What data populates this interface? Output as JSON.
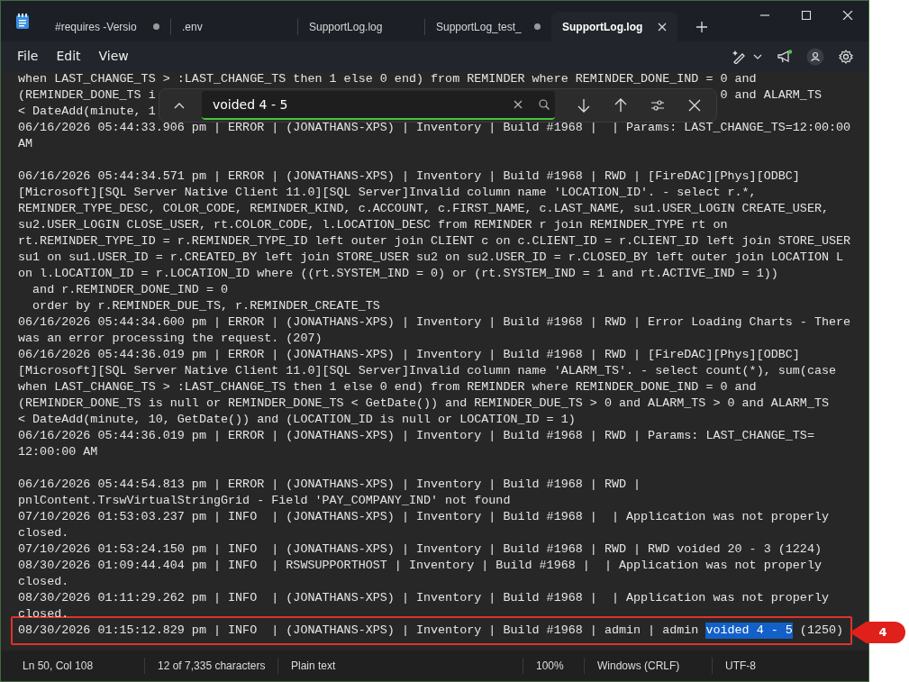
{
  "tabs": [
    {
      "label": "#requires -Versio",
      "modified": true,
      "selected": false
    },
    {
      "label": ".env",
      "modified": false,
      "selected": false
    },
    {
      "label": "SupportLog.log",
      "modified": false,
      "selected": false
    },
    {
      "label": "SupportLog_test_",
      "modified": true,
      "selected": false
    },
    {
      "label": "SupportLog.log",
      "modified": false,
      "selected": true
    }
  ],
  "menu": [
    "File",
    "Edit",
    "View"
  ],
  "find": {
    "value": "voided 4 - 5"
  },
  "lines": [
    {
      "kind": "text",
      "text": "when LAST_CHANGE_TS > :LAST_CHANGE_TS then 1 else 0 end) from REMINDER where REMINDER_DONE_IND = 0 and"
    },
    {
      "kind": "covered",
      "before": "(REMINDER_DONE_TS i",
      "after": "0 and ALARM_TS"
    },
    {
      "kind": "covered",
      "before": "< DateAdd(minute, 1"
    },
    {
      "kind": "text",
      "text": "06/16/2026 05:44:33.906 pm | ERROR | (JONATHANS-XPS) | Inventory | Build #1968 |  | Params: LAST_CHANGE_TS=12:00:00"
    },
    {
      "kind": "text",
      "text": "AM"
    },
    {
      "kind": "blank"
    },
    {
      "kind": "text",
      "text": "06/16/2026 05:44:34.571 pm | ERROR | (JONATHANS-XPS) | Inventory | Build #1968 | RWD | [FireDAC][Phys][ODBC]"
    },
    {
      "kind": "text",
      "text": "[Microsoft][SQL Server Native Client 11.0][SQL Server]Invalid column name 'LOCATION_ID'. - select r.*,"
    },
    {
      "kind": "text",
      "text": "REMINDER_TYPE_DESC, COLOR_CODE, REMINDER_KIND, c.ACCOUNT, c.FIRST_NAME, c.LAST_NAME, su1.USER_LOGIN CREATE_USER,"
    },
    {
      "kind": "text",
      "text": "su2.USER_LOGIN CLOSE_USER, rt.COLOR_CODE, l.LOCATION_DESC from REMINDER r join REMINDER_TYPE rt on"
    },
    {
      "kind": "text",
      "text": "rt.REMINDER_TYPE_ID = r.REMINDER_TYPE_ID left outer join CLIENT c on c.CLIENT_ID = r.CLIENT_ID left join STORE_USER"
    },
    {
      "kind": "text",
      "text": "su1 on su1.USER_ID = r.CREATED_BY left join STORE_USER su2 on su2.USER_ID = r.CLOSED_BY left outer join LOCATION L"
    },
    {
      "kind": "text",
      "text": "on l.LOCATION_ID = r.LOCATION_ID where ((rt.SYSTEM_IND = 0) or (rt.SYSTEM_IND = 1 and rt.ACTIVE_IND = 1))"
    },
    {
      "kind": "text",
      "text": "  and r.REMINDER_DONE_IND = 0"
    },
    {
      "kind": "text",
      "text": "  order by r.REMINDER_DUE_TS, r.REMINDER_CREATE_TS"
    },
    {
      "kind": "text",
      "text": "06/16/2026 05:44:34.600 pm | ERROR | (JONATHANS-XPS) | Inventory | Build #1968 | RWD | Error Loading Charts - There"
    },
    {
      "kind": "text",
      "text": "was an error processing the request. (207)"
    },
    {
      "kind": "text",
      "text": "06/16/2026 05:44:36.019 pm | ERROR | (JONATHANS-XPS) | Inventory | Build #1968 | RWD | [FireDAC][Phys][ODBC]"
    },
    {
      "kind": "text",
      "text": "[Microsoft][SQL Server Native Client 11.0][SQL Server]Invalid column name 'ALARM_TS'. - select count(*), sum(case"
    },
    {
      "kind": "text",
      "text": "when LAST_CHANGE_TS > :LAST_CHANGE_TS then 1 else 0 end) from REMINDER where REMINDER_DONE_IND = 0 and"
    },
    {
      "kind": "text",
      "text": "(REMINDER_DONE_TS is null or REMINDER_DONE_TS < GetDate()) and REMINDER_DUE_TS > 0 and ALARM_TS > 0 and ALARM_TS"
    },
    {
      "kind": "text",
      "text": "< DateAdd(minute, 10, GetDate()) and (LOCATION_ID is null or LOCATION_ID = 1)"
    },
    {
      "kind": "text",
      "text": "06/16/2026 05:44:36.019 pm | ERROR | (JONATHANS-XPS) | Inventory | Build #1968 | RWD | Params: LAST_CHANGE_TS="
    },
    {
      "kind": "text",
      "text": "12:00:00 AM"
    },
    {
      "kind": "blank"
    },
    {
      "kind": "text",
      "text": "06/16/2026 05:44:54.813 pm | ERROR | (JONATHANS-XPS) | Inventory | Build #1968 | RWD |"
    },
    {
      "kind": "text",
      "text": "pnlContent.TrswVirtualStringGrid - Field 'PAY_COMPANY_IND' not found"
    },
    {
      "kind": "text",
      "text": "07/10/2026 01:53:03.237 pm | INFO  | (JONATHANS-XPS) | Inventory | Build #1968 |  | Application was not properly"
    },
    {
      "kind": "text",
      "text": "closed."
    },
    {
      "kind": "text",
      "text": "07/10/2026 01:53:24.150 pm | INFO  | (JONATHANS-XPS) | Inventory | Build #1968 | RWD | RWD voided 20 - 3 (1224)"
    },
    {
      "kind": "text",
      "text": "08/30/2026 01:09:44.404 pm | INFO  | RSWSUPPORTHOST | Inventory | Build #1968 |  | Application was not properly"
    },
    {
      "kind": "text",
      "text": "closed."
    },
    {
      "kind": "text",
      "text": "08/30/2026 01:11:29.262 pm | INFO  | (JONATHANS-XPS) | Inventory | Build #1968 |  | Application was not properly"
    },
    {
      "kind": "text",
      "text": "closed."
    },
    {
      "kind": "match",
      "before": "08/30/2026 01:15:12.829 pm | INFO  | (JONATHANS-XPS) | Inventory | Build #1968 | admin | admin ",
      "match": "voided 4 - 5",
      "after": " (1250)",
      "annotated": true
    }
  ],
  "callout": {
    "label": "4"
  },
  "status_bar": [
    "Ln 50, Col 108",
    "12 of 7,335 characters",
    "Plain text",
    "100%",
    "Windows (CRLF)",
    "UTF-8"
  ]
}
